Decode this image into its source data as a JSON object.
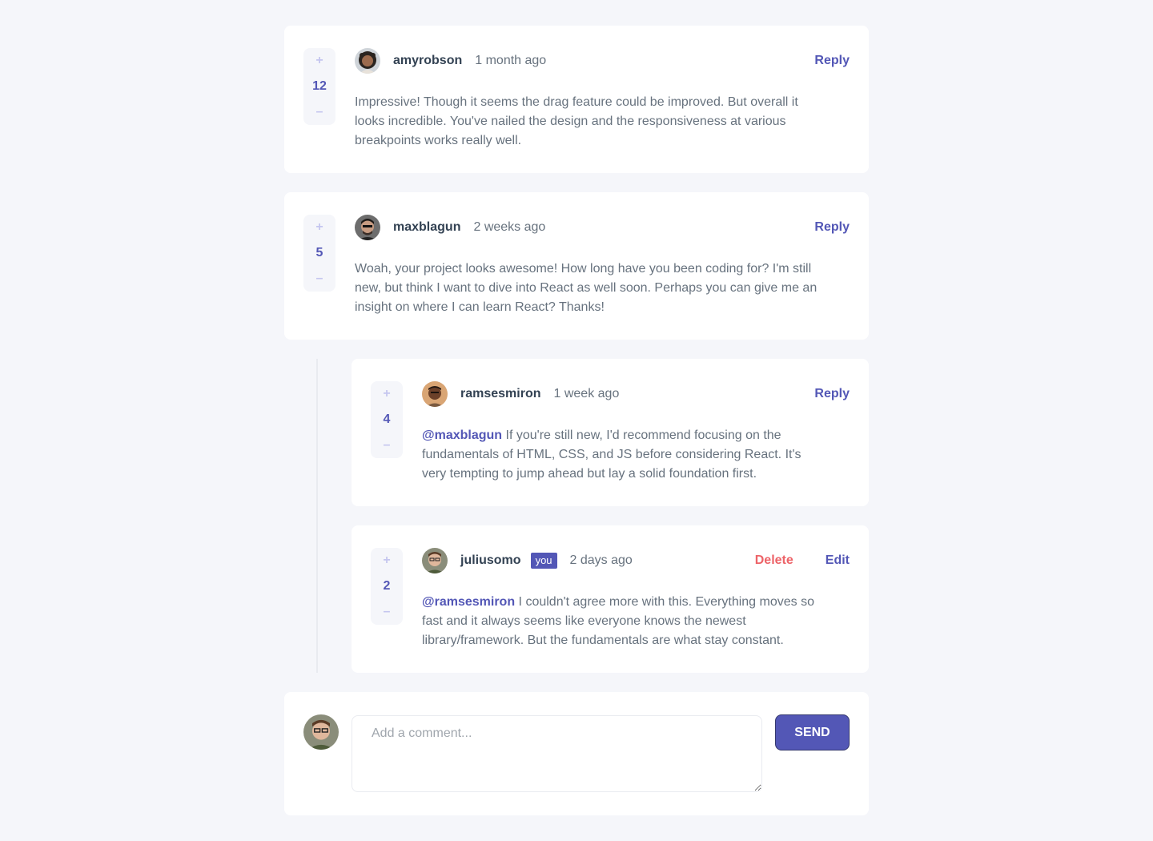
{
  "comments": [
    {
      "username": "amyrobson",
      "time": "1 month ago",
      "score": "12",
      "action": "Reply",
      "content": "Impressive! Though it seems the drag feature could be improved. But overall it looks incredible. You've nailed the design and the responsiveness at various breakpoints works really well.",
      "avatar_icon": "avatar-amyrobson"
    },
    {
      "username": "maxblagun",
      "time": "2 weeks ago",
      "score": "5",
      "action": "Reply",
      "content": "Woah, your project looks awesome! How long have you been coding for? I'm still new, but think I want to dive into React as well soon. Perhaps you can give me an insight on where I can learn React? Thanks!",
      "avatar_icon": "avatar-maxblagun"
    }
  ],
  "replies": [
    {
      "username": "ramsesmiron",
      "time": "1 week ago",
      "score": "4",
      "action": "Reply",
      "mention": "@maxblagun",
      "content": "If you're still new, I'd recommend focusing on the fundamentals of HTML, CSS, and JS before considering React. It's very tempting to jump ahead but lay a solid foundation first.",
      "avatar_icon": "avatar-ramsesmiron"
    },
    {
      "username": "juliusomo",
      "you_label": "you",
      "time": "2 days ago",
      "score": "2",
      "delete_label": "Delete",
      "edit_label": "Edit",
      "mention": "@ramsesmiron",
      "content": "I couldn't agree more with this. Everything moves so fast and it always seems like everyone knows the newest library/framework. But the fundamentals are what stay constant.",
      "avatar_icon": "avatar-juliusomo"
    }
  ],
  "vote": {
    "plus": "+",
    "minus": "–"
  },
  "compose": {
    "placeholder": "Add a comment...",
    "send_label": "SEND",
    "avatar_icon": "avatar-juliusomo"
  },
  "colors": {
    "primary": "#5357b6",
    "danger": "#ed6368",
    "background": "#f5f6fa",
    "text_dark": "#334253",
    "text": "#67727e",
    "vote_light": "#c5c6ef"
  }
}
